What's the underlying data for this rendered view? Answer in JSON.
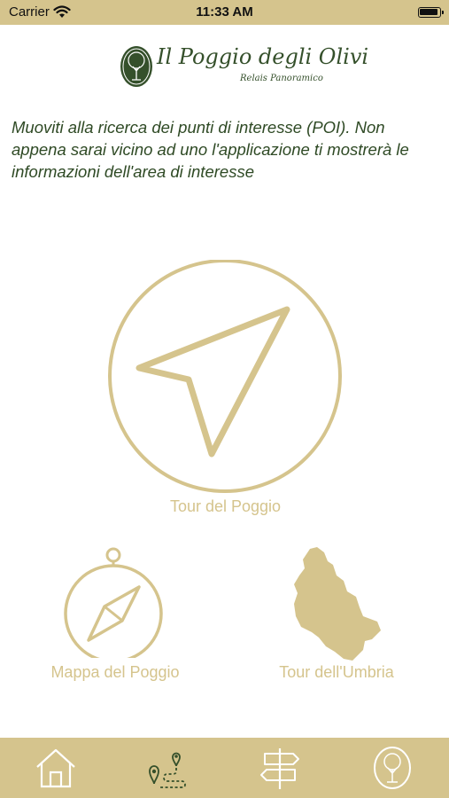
{
  "status_bar": {
    "carrier": "Carrier",
    "time": "11:33 AM"
  },
  "logo": {
    "name": "Il Poggio degli Olivi",
    "tagline": "Relais Panoramico"
  },
  "intro_text": "Muoviti alla ricerca dei punti di interesse (POI). Non appena sarai vicino ad uno l'applicazione ti mostrerà le informazioni dell'area di interesse",
  "tiles": {
    "main": {
      "label": "Tour del Poggio",
      "icon": "navigation-arrow-icon"
    },
    "map": {
      "label": "Mappa del Poggio",
      "icon": "compass-icon"
    },
    "umbria": {
      "label": "Tour dell'Umbria",
      "icon": "umbria-region-icon"
    }
  },
  "tab_bar": {
    "tabs": [
      {
        "icon": "home-icon"
      },
      {
        "icon": "route-pin-icon"
      },
      {
        "icon": "signpost-icon"
      },
      {
        "icon": "olive-tree-logo-icon"
      }
    ]
  },
  "colors": {
    "accent_gold": "#d5c48d",
    "text_green": "#2f4a25",
    "background": "#ffffff"
  }
}
